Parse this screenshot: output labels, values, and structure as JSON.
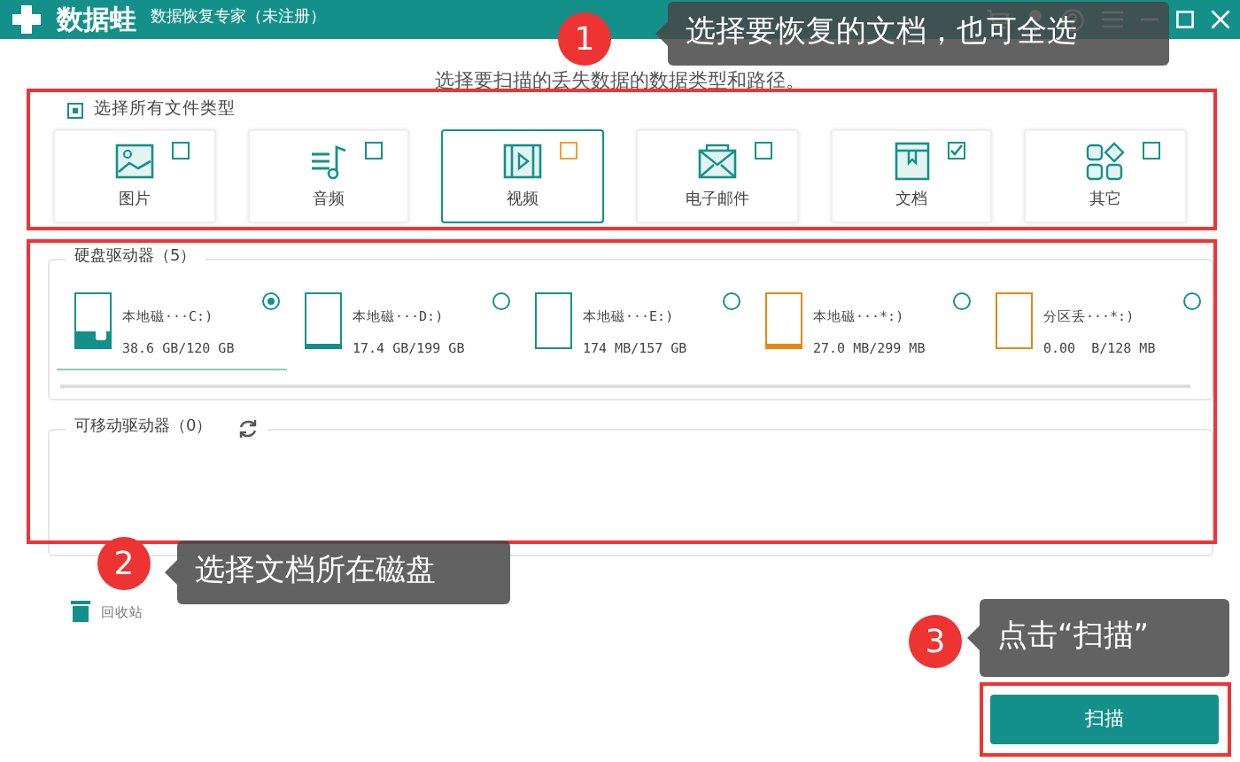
{
  "window": {
    "logo": "数据蛙",
    "title": "数据恢复专家（未注册）"
  },
  "subtitle": "选择要扫描的丢失数据的数据类型和路径。",
  "select_all": {
    "label": "选择所有文件类型",
    "indeterminate": true
  },
  "file_types": [
    {
      "label": "图片",
      "kind": "image",
      "checked": false,
      "selected": false
    },
    {
      "label": "音频",
      "kind": "audio",
      "checked": false,
      "selected": false
    },
    {
      "label": "视频",
      "kind": "video",
      "checked": false,
      "selected": true
    },
    {
      "label": "电子邮件",
      "kind": "email",
      "checked": false,
      "selected": false
    },
    {
      "label": "文档",
      "kind": "document",
      "checked": true,
      "selected": false
    },
    {
      "label": "其它",
      "kind": "other",
      "checked": false,
      "selected": false
    }
  ],
  "hard_drives": {
    "title": "硬盘驱动器（5）",
    "drives": [
      {
        "name": "本地磁···C:)",
        "usage": "38.6 GB/120 GB",
        "level": 0.32,
        "color": "#14908a",
        "kind": "system",
        "selected": true
      },
      {
        "name": "本地磁···D:)",
        "usage": "17.4 GB/199 GB",
        "level": 0.09,
        "color": "#14908a",
        "kind": "data",
        "selected": false
      },
      {
        "name": "本地磁···E:)",
        "usage": "174 MB/157 GB",
        "level": 0,
        "color": "#14908a",
        "kind": "data",
        "selected": false
      },
      {
        "name": "本地磁···*:)",
        "usage": "27.0 MB/299 MB",
        "level": 0.09,
        "color": "#e8860f",
        "kind": "data",
        "selected": false
      },
      {
        "name": "分区丢···*:)",
        "usage": "0.00  B/128 MB",
        "level": 0,
        "color": "#e8860f",
        "kind": "data",
        "selected": false
      }
    ]
  },
  "removable_drives": {
    "title": "可移动驱动器（0）"
  },
  "recycle_bin": "回收站",
  "scan_button": "扫描",
  "callouts": [
    {
      "number": "1",
      "text": "选择要恢复的文档，也可全选"
    },
    {
      "number": "2",
      "text": "选择文档所在磁盘"
    },
    {
      "number": "3",
      "text": "点击“扫描”"
    }
  ]
}
